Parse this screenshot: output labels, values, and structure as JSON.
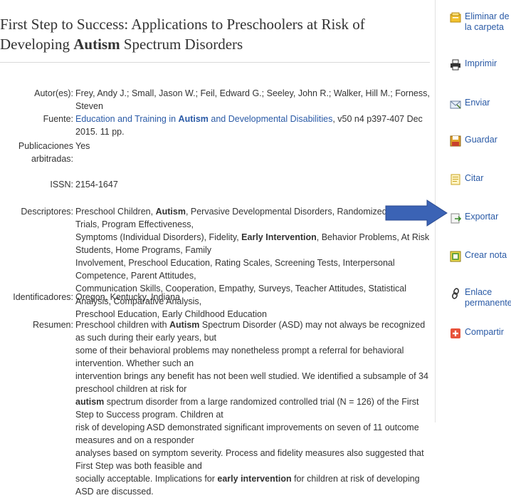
{
  "title": {
    "pre": "First Step to Success: Applications to Preschoolers at Risk of Developing ",
    "bold": "Autism",
    "post": " Spectrum Disorders"
  },
  "fields": {
    "authors_label": "Autor(es):",
    "authors": "Frey, Andy J.; Small, Jason W.; Feil, Edward G.; Seeley, John R.; Walker, Hill M.; Forness, Steven",
    "source_label": "Fuente:",
    "source_pre": "Education and Training in ",
    "source_bold": "Autism",
    "source_post": " and Developmental Disabilities",
    "source_details": ", v50 n4 p397-407 Dec 2015. 11 pp.",
    "peer_label_1": "Publicaciones",
    "peer_label_2": "arbitradas:",
    "peer_value": "Yes",
    "issn_label": "ISSN:",
    "issn_value": "2154-1647",
    "desc_label": "Descriptores:",
    "desc_1": "Preschool Children, ",
    "desc_bold_1": "Autism",
    "desc_2": ", Pervasive Developmental Disorders, Randomized Controlled Trials, Program Effectiveness,",
    "desc_3": "Symptoms (Individual Disorders), Fidelity, ",
    "desc_bold_2": "Early Intervention",
    "desc_4": ", Behavior Problems, At Risk Students, Home Programs, Family",
    "desc_5": "Involvement, Preschool Education, Rating Scales, Screening Tests, Interpersonal Competence, Parent Attitudes,",
    "desc_6": "Communication Skills, Cooperation, Empathy, Surveys, Teacher Attitudes, Statistical Analysis, Comparative Analysis,",
    "desc_7": "Preschool Education, Early Childhood Education",
    "ident_label": "Identificadores:",
    "ident_value": "Oregon, Kentucky, Indiana",
    "abstract_label": "Resumen:",
    "abs_1a": "Preschool children with ",
    "abs_1b": "Autism",
    "abs_1c": " Spectrum Disorder (ASD) may not always be recognized as such during their early years, but",
    "abs_2": "some of their behavioral problems may nonetheless prompt a referral for behavioral intervention. Whether such an",
    "abs_3": "intervention brings any benefit has not been well studied. We identified a subsample of 34 preschool children at risk for",
    "abs_4a": "autism",
    "abs_4b": " spectrum disorder from a large randomized controlled trial (N = 126) of the First Step to Success program. Children at",
    "abs_5": "risk of developing ASD demonstrated significant improvements on seven of 11 outcome measures and on a responder",
    "abs_6": "analyses based on symptom severity. Process and fidelity measures also suggested that First Step was both feasible and",
    "abs_7": "socially acceptable. Implications for ",
    "abs_7b": "early intervention",
    "abs_7c": " for children at risk of developing ASD are discussed."
  },
  "sidebar": {
    "eliminar_1": "Eliminar de",
    "eliminar_2": "la carpeta",
    "imprimir": "Imprimir",
    "enviar": "Enviar",
    "guardar": "Guardar",
    "citar": "Citar",
    "exportar": "Exportar",
    "crear_nota": "Crear nota",
    "enlace_1": "Enlace",
    "enlace_2": "permanente",
    "compartir": "Compartir"
  },
  "colors": {
    "link": "#2a5aa6",
    "arrow": "#3b63b5",
    "share": "#e8533b"
  },
  "icons": [
    "folder-remove-icon",
    "printer-icon",
    "email-icon",
    "save-icon",
    "cite-icon",
    "export-icon",
    "note-icon",
    "link-icon",
    "share-icon",
    "arrow-pointer-icon"
  ]
}
